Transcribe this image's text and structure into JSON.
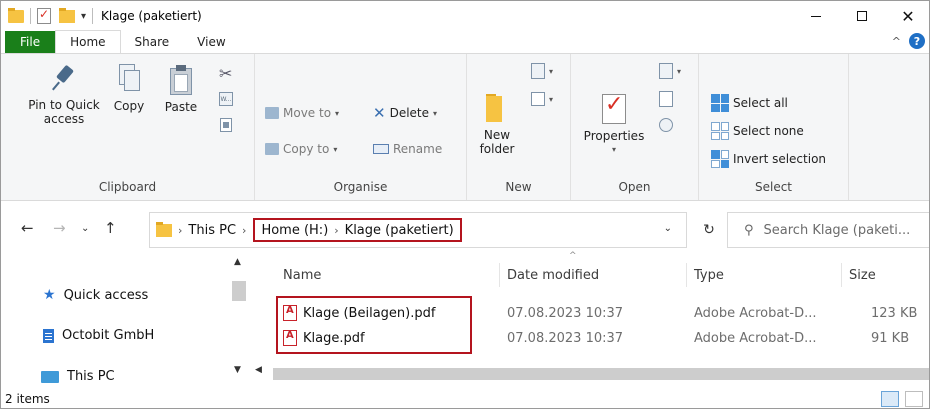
{
  "window": {
    "title": "Klage (paketiert)"
  },
  "tabs": {
    "file": "File",
    "home": "Home",
    "share": "Share",
    "view": "View"
  },
  "ribbon": {
    "clipboard": {
      "label": "Clipboard",
      "pin": "Pin to Quick access",
      "pin_line1": "Pin to Quick",
      "pin_line2": "access",
      "copy": "Copy",
      "paste": "Paste"
    },
    "organise": {
      "label": "Organise",
      "move_to": "Move to",
      "delete": "Delete",
      "copy_to": "Copy to",
      "rename": "Rename"
    },
    "new": {
      "label": "New",
      "new_folder_line1": "New",
      "new_folder_line2": "folder"
    },
    "open": {
      "label": "Open",
      "properties": "Properties"
    },
    "select": {
      "label": "Select",
      "select_all": "Select all",
      "select_none": "Select none",
      "invert_selection": "Invert selection"
    }
  },
  "address": {
    "crumbs": [
      "This PC",
      "Home (H:)",
      "Klage (paketiert)"
    ],
    "search_placeholder": "Search Klage (paketi..."
  },
  "navpane": {
    "items": [
      {
        "label": "Quick access",
        "icon": "star-icon"
      },
      {
        "label": "Octobit GmbH",
        "icon": "building-icon"
      },
      {
        "label": "This PC",
        "icon": "pc-icon"
      }
    ]
  },
  "filelist": {
    "columns": [
      "Name",
      "Date modified",
      "Type",
      "Size"
    ],
    "rows": [
      {
        "name": "Klage (Beilagen).pdf",
        "date": "07.08.2023 10:37",
        "type": "Adobe Acrobat-D...",
        "size": "123 KB"
      },
      {
        "name": "Klage.pdf",
        "date": "07.08.2023 10:37",
        "type": "Adobe Acrobat-D...",
        "size": "91 KB"
      }
    ]
  },
  "status": {
    "items": "2 items"
  },
  "colors": {
    "file_tab": "#1a7f1a",
    "highlight": "#b4141e",
    "accent": "#2b74d0"
  }
}
